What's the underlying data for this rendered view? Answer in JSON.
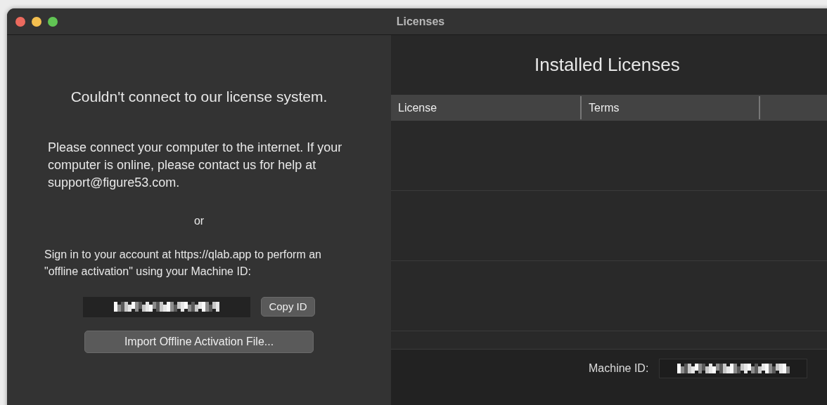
{
  "window": {
    "title": "Licenses"
  },
  "status_panel": {
    "heading": "Couldn't connect to our license system.",
    "message": "Please connect your computer to the internet. If your computer is online, please contact us for help at support@figure53.com.",
    "separator": "or",
    "instructions": "Sign in to your account at https://qlab.app to perform an \"offline activation\" using your Machine ID:",
    "copy_button": "Copy ID",
    "import_button": "Import Offline Activation File..."
  },
  "licenses_panel": {
    "title": "Installed Licenses",
    "table": {
      "columns": [
        "License",
        "Terms"
      ]
    },
    "footer": {
      "label": "Machine ID:"
    }
  }
}
